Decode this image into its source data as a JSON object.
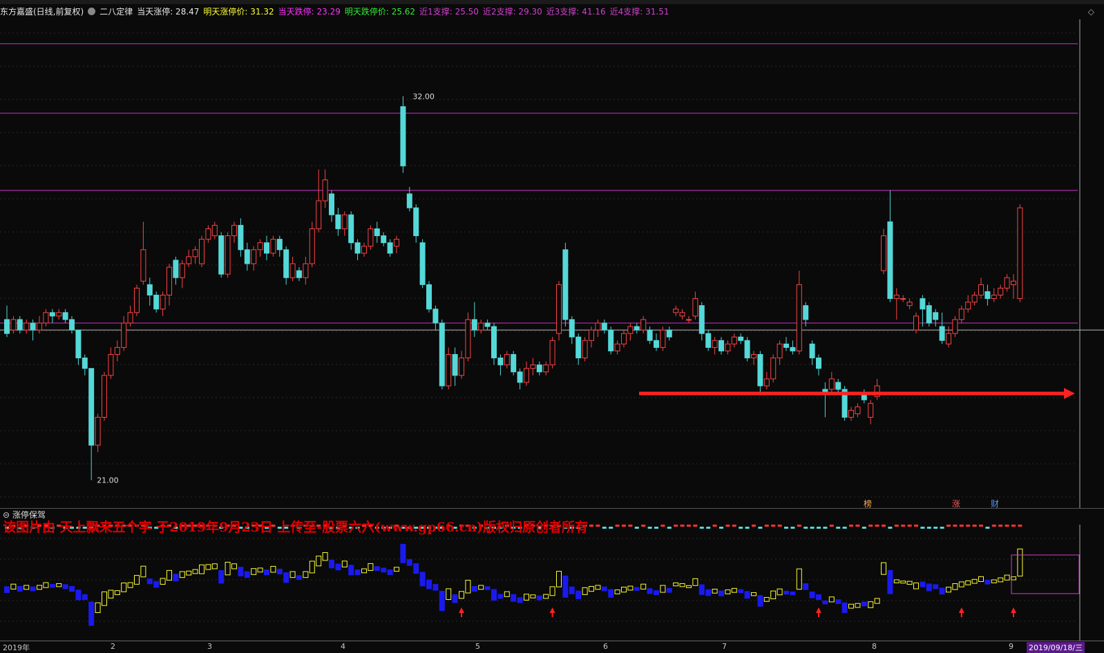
{
  "info": {
    "stock": "东方嘉盛(日线,前复权)",
    "indicator": "二八定律",
    "today_limit": "当天涨停: 28.47",
    "tomorrow_limit": "明天涨停价: 31.32",
    "today_down": "当天跌停: 23.29",
    "tomorrow_down": "明天跌停价: 25.62",
    "support1": "近1支撑: 25.50",
    "support2": "近2支撑: 29.30",
    "support3": "近3支撑: 41.16",
    "support4": "近4支撑: 31.51"
  },
  "colors": {
    "up": "#ff4444",
    "down": "#55d8d8",
    "purple": "#cc33cc",
    "yellow": "#ffff33",
    "blue": "#1a1aee",
    "arrow": "#ff2222"
  },
  "main": {
    "high_label": "32.00",
    "low_label": "21.00",
    "markers": [
      "榜",
      "涨",
      "财"
    ]
  },
  "sub": {
    "title": "涨停保驾",
    "watermark": "该图片由 天上飘来五个字 于2019年9月23日 上传至-股票六六(www.gp66.cn)版权归原创者所有"
  },
  "axis": {
    "labels": [
      "2019年",
      "2",
      "3",
      "4",
      "5",
      "6",
      "7",
      "8",
      "9"
    ],
    "current": "2019/09/18/三"
  },
  "chart_data": {
    "type": "candlestick",
    "ylim": [
      20.2,
      34.2
    ],
    "support_lines": [
      25.5,
      29.3,
      31.51,
      33.5
    ],
    "reference_line": 25.3,
    "candles": [
      {
        "o": 25.6,
        "c": 25.2,
        "h": 26.0,
        "l": 25.1
      },
      {
        "o": 25.3,
        "c": 25.6,
        "h": 25.7,
        "l": 25.2
      },
      {
        "o": 25.6,
        "c": 25.3,
        "h": 25.7,
        "l": 25.2
      },
      {
        "o": 25.3,
        "c": 25.5,
        "h": 25.6,
        "l": 25.2
      },
      {
        "o": 25.5,
        "c": 25.3,
        "h": 25.6,
        "l": 25.0
      },
      {
        "o": 25.3,
        "c": 25.5,
        "h": 25.7,
        "l": 25.2
      },
      {
        "o": 25.5,
        "c": 25.8,
        "h": 25.9,
        "l": 25.4
      },
      {
        "o": 25.8,
        "c": 25.7,
        "h": 25.9,
        "l": 25.5
      },
      {
        "o": 25.7,
        "c": 25.8,
        "h": 25.9,
        "l": 25.6
      },
      {
        "o": 25.8,
        "c": 25.6,
        "h": 25.9,
        "l": 25.5
      },
      {
        "o": 25.6,
        "c": 25.3,
        "h": 25.7,
        "l": 25.2
      },
      {
        "o": 25.3,
        "c": 24.5,
        "h": 25.3,
        "l": 24.3
      },
      {
        "o": 24.5,
        "c": 24.2,
        "h": 24.6,
        "l": 24.0
      },
      {
        "o": 24.2,
        "c": 22.0,
        "h": 24.2,
        "l": 21.0
      },
      {
        "o": 22.0,
        "c": 22.8,
        "h": 22.9,
        "l": 21.8
      },
      {
        "o": 22.8,
        "c": 24.0,
        "h": 24.1,
        "l": 22.7
      },
      {
        "o": 24.0,
        "c": 24.6,
        "h": 24.8,
        "l": 23.9
      },
      {
        "o": 24.6,
        "c": 24.8,
        "h": 25.0,
        "l": 24.4
      },
      {
        "o": 24.8,
        "c": 25.5,
        "h": 25.7,
        "l": 24.7
      },
      {
        "o": 25.5,
        "c": 25.8,
        "h": 26.0,
        "l": 25.4
      },
      {
        "o": 25.8,
        "c": 26.5,
        "h": 26.6,
        "l": 25.7
      },
      {
        "o": 26.7,
        "c": 27.6,
        "h": 28.4,
        "l": 26.6
      },
      {
        "o": 26.6,
        "c": 26.3,
        "h": 26.8,
        "l": 26.0
      },
      {
        "o": 26.3,
        "c": 25.9,
        "h": 26.4,
        "l": 25.8
      },
      {
        "o": 25.9,
        "c": 26.3,
        "h": 26.4,
        "l": 25.7
      },
      {
        "o": 26.3,
        "c": 27.1,
        "h": 27.2,
        "l": 26.0
      },
      {
        "o": 27.3,
        "c": 26.8,
        "h": 27.4,
        "l": 26.6
      },
      {
        "o": 26.8,
        "c": 27.2,
        "h": 27.3,
        "l": 26.5
      },
      {
        "o": 27.2,
        "c": 27.4,
        "h": 27.6,
        "l": 27.1
      },
      {
        "o": 27.4,
        "c": 27.6,
        "h": 27.7,
        "l": 27.2
      },
      {
        "o": 27.2,
        "c": 27.9,
        "h": 28.0,
        "l": 27.1
      },
      {
        "o": 27.9,
        "c": 28.2,
        "h": 28.3,
        "l": 27.8
      },
      {
        "o": 28.0,
        "c": 28.3,
        "h": 28.4,
        "l": 27.9
      },
      {
        "o": 28.0,
        "c": 26.9,
        "h": 28.1,
        "l": 26.8
      },
      {
        "o": 26.9,
        "c": 28.0,
        "h": 28.1,
        "l": 26.8
      },
      {
        "o": 28.0,
        "c": 28.3,
        "h": 28.4,
        "l": 27.8
      },
      {
        "o": 28.3,
        "c": 27.6,
        "h": 28.5,
        "l": 27.4
      },
      {
        "o": 27.6,
        "c": 27.2,
        "h": 27.8,
        "l": 27.0
      },
      {
        "o": 27.2,
        "c": 27.6,
        "h": 27.7,
        "l": 27.0
      },
      {
        "o": 27.6,
        "c": 27.8,
        "h": 27.9,
        "l": 27.4
      },
      {
        "o": 27.8,
        "c": 27.5,
        "h": 28.0,
        "l": 27.3
      },
      {
        "o": 27.5,
        "c": 27.9,
        "h": 28.0,
        "l": 27.4
      },
      {
        "o": 27.9,
        "c": 27.6,
        "h": 28.0,
        "l": 27.4
      },
      {
        "o": 27.6,
        "c": 26.8,
        "h": 27.7,
        "l": 26.6
      },
      {
        "o": 26.8,
        "c": 27.2,
        "h": 27.4,
        "l": 26.7
      },
      {
        "o": 27.0,
        "c": 26.8,
        "h": 27.1,
        "l": 26.7
      },
      {
        "o": 26.8,
        "c": 27.2,
        "h": 27.4,
        "l": 26.6
      },
      {
        "o": 27.2,
        "c": 28.2,
        "h": 28.4,
        "l": 27.1
      },
      {
        "o": 28.2,
        "c": 29.0,
        "h": 29.9,
        "l": 28.1
      },
      {
        "o": 29.0,
        "c": 29.6,
        "h": 29.9,
        "l": 28.8
      },
      {
        "o": 29.2,
        "c": 28.6,
        "h": 29.3,
        "l": 28.4
      },
      {
        "o": 28.6,
        "c": 28.2,
        "h": 28.8,
        "l": 28.0
      },
      {
        "o": 28.2,
        "c": 28.6,
        "h": 28.7,
        "l": 28.0
      },
      {
        "o": 28.6,
        "c": 27.8,
        "h": 28.7,
        "l": 27.6
      },
      {
        "o": 27.8,
        "c": 27.5,
        "h": 27.9,
        "l": 27.3
      },
      {
        "o": 27.5,
        "c": 27.7,
        "h": 27.8,
        "l": 27.4
      },
      {
        "o": 27.7,
        "c": 28.2,
        "h": 28.3,
        "l": 27.6
      },
      {
        "o": 28.2,
        "c": 28.0,
        "h": 28.4,
        "l": 27.8
      },
      {
        "o": 28.0,
        "c": 27.8,
        "h": 28.1,
        "l": 27.7
      },
      {
        "o": 27.8,
        "c": 27.5,
        "h": 27.9,
        "l": 27.4
      },
      {
        "o": 27.7,
        "c": 27.9,
        "h": 28.0,
        "l": 27.5
      },
      {
        "o": 31.7,
        "c": 30.0,
        "h": 32.0,
        "l": 29.8
      },
      {
        "o": 29.2,
        "c": 28.8,
        "h": 29.4,
        "l": 28.7
      },
      {
        "o": 28.8,
        "c": 28.0,
        "h": 28.9,
        "l": 27.8
      },
      {
        "o": 27.8,
        "c": 26.6,
        "h": 27.9,
        "l": 26.5
      },
      {
        "o": 26.6,
        "c": 25.9,
        "h": 26.7,
        "l": 25.8
      },
      {
        "o": 25.9,
        "c": 25.5,
        "h": 26.0,
        "l": 25.3
      },
      {
        "o": 25.5,
        "c": 23.7,
        "h": 25.6,
        "l": 23.6
      },
      {
        "o": 23.7,
        "c": 24.6,
        "h": 24.8,
        "l": 23.6
      },
      {
        "o": 24.6,
        "c": 24.0,
        "h": 24.8,
        "l": 23.7
      },
      {
        "o": 24.0,
        "c": 24.5,
        "h": 24.7,
        "l": 23.9
      },
      {
        "o": 24.5,
        "c": 25.6,
        "h": 25.8,
        "l": 24.4
      },
      {
        "o": 25.6,
        "c": 25.3,
        "h": 26.1,
        "l": 25.1
      },
      {
        "o": 25.3,
        "c": 25.5,
        "h": 25.6,
        "l": 25.2
      },
      {
        "o": 25.5,
        "c": 25.4,
        "h": 25.6,
        "l": 25.3
      },
      {
        "o": 25.4,
        "c": 24.5,
        "h": 25.5,
        "l": 24.3
      },
      {
        "o": 24.5,
        "c": 24.3,
        "h": 24.6,
        "l": 24.0
      },
      {
        "o": 24.3,
        "c": 24.6,
        "h": 24.7,
        "l": 24.2
      },
      {
        "o": 24.6,
        "c": 24.1,
        "h": 24.7,
        "l": 24.0
      },
      {
        "o": 24.1,
        "c": 23.8,
        "h": 24.2,
        "l": 23.6
      },
      {
        "o": 23.8,
        "c": 24.2,
        "h": 24.4,
        "l": 23.7
      },
      {
        "o": 24.2,
        "c": 24.3,
        "h": 24.5,
        "l": 24.0
      },
      {
        "o": 24.3,
        "c": 24.1,
        "h": 24.4,
        "l": 24.0
      },
      {
        "o": 24.1,
        "c": 24.3,
        "h": 24.4,
        "l": 24.0
      },
      {
        "o": 24.3,
        "c": 25.0,
        "h": 25.1,
        "l": 24.2
      },
      {
        "o": 25.2,
        "c": 26.6,
        "h": 26.7,
        "l": 25.0
      },
      {
        "o": 27.6,
        "c": 25.6,
        "h": 27.8,
        "l": 25.4
      },
      {
        "o": 25.6,
        "c": 25.1,
        "h": 25.7,
        "l": 24.9
      },
      {
        "o": 25.1,
        "c": 24.5,
        "h": 25.2,
        "l": 24.3
      },
      {
        "o": 24.5,
        "c": 25.0,
        "h": 25.1,
        "l": 24.4
      },
      {
        "o": 25.0,
        "c": 25.3,
        "h": 25.4,
        "l": 24.8
      },
      {
        "o": 25.3,
        "c": 25.5,
        "h": 25.6,
        "l": 25.1
      },
      {
        "o": 25.5,
        "c": 25.3,
        "h": 25.6,
        "l": 25.2
      },
      {
        "o": 25.3,
        "c": 24.7,
        "h": 25.4,
        "l": 24.6
      },
      {
        "o": 24.7,
        "c": 24.9,
        "h": 25.0,
        "l": 24.6
      },
      {
        "o": 24.9,
        "c": 25.2,
        "h": 25.3,
        "l": 24.8
      },
      {
        "o": 25.2,
        "c": 25.4,
        "h": 25.5,
        "l": 25.0
      },
      {
        "o": 25.4,
        "c": 25.3,
        "h": 25.5,
        "l": 25.2
      },
      {
        "o": 25.3,
        "c": 25.6,
        "h": 25.7,
        "l": 25.2
      },
      {
        "o": 25.3,
        "c": 25.0,
        "h": 25.4,
        "l": 24.9
      },
      {
        "o": 25.0,
        "c": 24.8,
        "h": 25.2,
        "l": 24.7
      },
      {
        "o": 24.8,
        "c": 25.3,
        "h": 25.4,
        "l": 24.7
      },
      {
        "o": 25.3,
        "c": 25.1,
        "h": 25.4,
        "l": 25.0
      },
      {
        "o": 25.8,
        "c": 25.9,
        "h": 26.0,
        "l": 25.7
      },
      {
        "o": 25.7,
        "c": 25.8,
        "h": 25.9,
        "l": 25.6
      },
      {
        "o": 25.6,
        "c": 25.6,
        "h": 25.7,
        "l": 25.5
      },
      {
        "o": 25.7,
        "c": 26.2,
        "h": 26.4,
        "l": 25.6
      },
      {
        "o": 26.0,
        "c": 25.2,
        "h": 26.1,
        "l": 25.0
      },
      {
        "o": 25.2,
        "c": 24.8,
        "h": 25.3,
        "l": 24.7
      },
      {
        "o": 24.8,
        "c": 25.0,
        "h": 25.1,
        "l": 24.6
      },
      {
        "o": 25.0,
        "c": 24.7,
        "h": 25.1,
        "l": 24.6
      },
      {
        "o": 24.7,
        "c": 24.9,
        "h": 25.0,
        "l": 24.6
      },
      {
        "o": 24.9,
        "c": 25.1,
        "h": 25.2,
        "l": 24.8
      },
      {
        "o": 25.1,
        "c": 25.0,
        "h": 25.2,
        "l": 24.9
      },
      {
        "o": 25.0,
        "c": 24.5,
        "h": 25.1,
        "l": 24.4
      },
      {
        "o": 24.5,
        "c": 24.6,
        "h": 24.7,
        "l": 24.3
      },
      {
        "o": 24.6,
        "c": 23.7,
        "h": 24.7,
        "l": 23.5
      },
      {
        "o": 23.7,
        "c": 23.9,
        "h": 24.1,
        "l": 23.6
      },
      {
        "o": 23.9,
        "c": 24.5,
        "h": 24.6,
        "l": 23.8
      },
      {
        "o": 24.5,
        "c": 24.9,
        "h": 25.0,
        "l": 24.3
      },
      {
        "o": 24.9,
        "c": 24.8,
        "h": 25.1,
        "l": 24.7
      },
      {
        "o": 24.8,
        "c": 24.7,
        "h": 25.0,
        "l": 24.6
      },
      {
        "o": 24.7,
        "c": 26.6,
        "h": 27.0,
        "l": 24.6
      },
      {
        "o": 26.0,
        "c": 25.6,
        "h": 26.1,
        "l": 25.4
      },
      {
        "o": 24.9,
        "c": 24.5,
        "h": 25.0,
        "l": 24.3
      },
      {
        "o": 24.5,
        "c": 24.2,
        "h": 24.6,
        "l": 24.0
      },
      {
        "o": 23.6,
        "c": 23.5,
        "h": 23.8,
        "l": 22.8
      },
      {
        "o": 23.6,
        "c": 23.9,
        "h": 24.1,
        "l": 23.5
      },
      {
        "o": 23.8,
        "c": 23.6,
        "h": 23.9,
        "l": 23.5
      },
      {
        "o": 23.6,
        "c": 22.8,
        "h": 23.7,
        "l": 22.7
      },
      {
        "o": 22.8,
        "c": 23.0,
        "h": 23.1,
        "l": 22.7
      },
      {
        "o": 22.9,
        "c": 23.1,
        "h": 23.2,
        "l": 22.8
      },
      {
        "o": 23.5,
        "c": 23.3,
        "h": 23.6,
        "l": 23.2
      },
      {
        "o": 22.8,
        "c": 23.2,
        "h": 23.3,
        "l": 22.6
      },
      {
        "o": 23.4,
        "c": 23.7,
        "h": 23.9,
        "l": 23.3
      },
      {
        "o": 27.0,
        "c": 28.0,
        "h": 28.2,
        "l": 26.9
      },
      {
        "o": 28.4,
        "c": 26.2,
        "h": 29.3,
        "l": 26.1
      },
      {
        "o": 26.2,
        "c": 26.3,
        "h": 26.5,
        "l": 25.6
      },
      {
        "o": 26.2,
        "c": 26.2,
        "h": 26.3,
        "l": 26.1
      },
      {
        "o": 26.0,
        "c": 26.1,
        "h": 26.2,
        "l": 25.9
      },
      {
        "o": 25.3,
        "c": 25.7,
        "h": 25.8,
        "l": 25.2
      },
      {
        "o": 26.2,
        "c": 25.9,
        "h": 26.3,
        "l": 25.4
      },
      {
        "o": 26.0,
        "c": 25.5,
        "h": 26.1,
        "l": 25.4
      },
      {
        "o": 25.8,
        "c": 25.6,
        "h": 25.9,
        "l": 25.4
      },
      {
        "o": 25.4,
        "c": 25.0,
        "h": 25.8,
        "l": 24.9
      },
      {
        "o": 24.9,
        "c": 25.2,
        "h": 25.4,
        "l": 24.8
      },
      {
        "o": 25.2,
        "c": 25.6,
        "h": 25.7,
        "l": 25.1
      },
      {
        "o": 25.6,
        "c": 25.9,
        "h": 26.0,
        "l": 25.5
      },
      {
        "o": 25.9,
        "c": 26.1,
        "h": 26.3,
        "l": 25.8
      },
      {
        "o": 26.1,
        "c": 26.3,
        "h": 26.4,
        "l": 26.0
      },
      {
        "o": 26.3,
        "c": 26.6,
        "h": 26.8,
        "l": 26.2
      },
      {
        "o": 26.4,
        "c": 26.2,
        "h": 26.6,
        "l": 26.0
      },
      {
        "o": 26.2,
        "c": 26.3,
        "h": 26.5,
        "l": 26.1
      },
      {
        "o": 26.3,
        "c": 26.5,
        "h": 26.6,
        "l": 26.2
      },
      {
        "o": 26.5,
        "c": 26.8,
        "h": 26.9,
        "l": 26.4
      },
      {
        "o": 26.6,
        "c": 26.7,
        "h": 26.9,
        "l": 26.2
      },
      {
        "o": 26.2,
        "c": 28.8,
        "h": 28.9,
        "l": 26.1
      }
    ]
  }
}
